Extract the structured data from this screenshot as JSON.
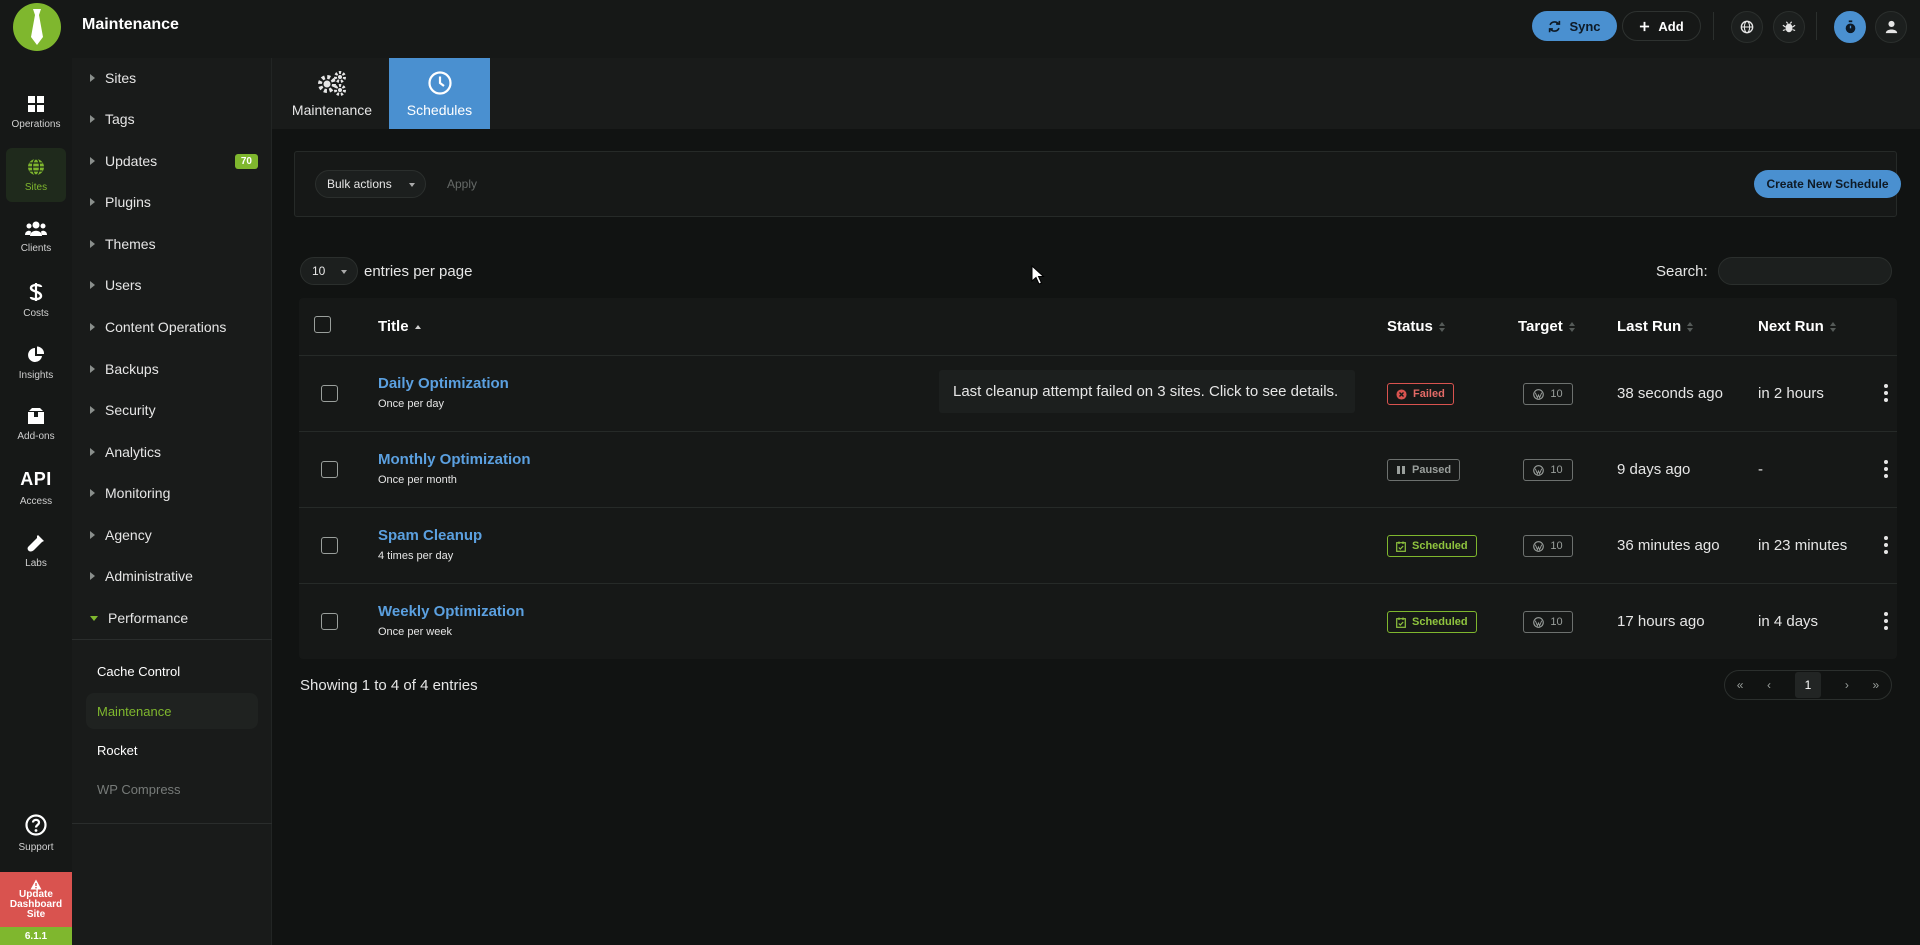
{
  "app": {
    "title": "Maintenance"
  },
  "top": {
    "sync_label": "Sync",
    "add_label": "Add"
  },
  "rail": {
    "items": [
      {
        "label": "Operations",
        "icon": "grid-icon"
      },
      {
        "label": "Sites",
        "icon": "globe-icon"
      },
      {
        "label": "Clients",
        "icon": "users-icon"
      },
      {
        "label": "Costs",
        "icon": "dollar-icon"
      },
      {
        "label": "Insights",
        "icon": "pie-chart-icon"
      },
      {
        "label": "Add-ons",
        "icon": "box-icon"
      },
      {
        "label": "Access",
        "icon_text": "API"
      },
      {
        "label": "Labs",
        "icon": "flask-icon"
      }
    ],
    "support_label": "Support",
    "update_label_1": "Update",
    "update_label_2": "Dashboard",
    "update_label_3": "Site",
    "version": "6.1.1"
  },
  "sidebar": {
    "items": [
      {
        "label": "Sites"
      },
      {
        "label": "Tags"
      },
      {
        "label": "Updates",
        "badge": "70"
      },
      {
        "label": "Plugins"
      },
      {
        "label": "Themes"
      },
      {
        "label": "Users"
      },
      {
        "label": "Content Operations"
      },
      {
        "label": "Backups"
      },
      {
        "label": "Security"
      },
      {
        "label": "Analytics"
      },
      {
        "label": "Monitoring"
      },
      {
        "label": "Agency"
      },
      {
        "label": "Administrative"
      },
      {
        "label": "Performance"
      }
    ],
    "sub_items": [
      {
        "label": "Cache Control"
      },
      {
        "label": "Maintenance"
      },
      {
        "label": "Rocket"
      },
      {
        "label": "WP Compress"
      }
    ]
  },
  "tabs": [
    {
      "label": "Maintenance",
      "icon": "gears-icon"
    },
    {
      "label": "Schedules",
      "icon": "clock-icon"
    }
  ],
  "toolbar": {
    "bulk_actions": "Bulk actions",
    "apply": "Apply",
    "create": "Create New Schedule"
  },
  "listing": {
    "per_page": "10",
    "per_page_label": "entries per page",
    "search_label": "Search:",
    "search_value": "",
    "showing": "Showing 1 to 4 of 4 entries"
  },
  "table": {
    "headers": {
      "title": "Title",
      "status": "Status",
      "target": "Target",
      "last_run": "Last Run",
      "next_run": "Next Run"
    },
    "rows": [
      {
        "title": "Daily Optimization",
        "frequency": "Once per day",
        "status": "Failed",
        "target": "10",
        "last_run": "38 seconds ago",
        "next_run": "in 2 hours"
      },
      {
        "title": "Monthly Optimization",
        "frequency": "Once per month",
        "status": "Paused",
        "target": "10",
        "last_run": "9 days ago",
        "next_run": "-"
      },
      {
        "title": "Spam Cleanup",
        "frequency": "4 times per day",
        "status": "Scheduled",
        "target": "10",
        "last_run": "36 minutes ago",
        "next_run": "in 23 minutes"
      },
      {
        "title": "Weekly Optimization",
        "frequency": "Once per week",
        "status": "Scheduled",
        "target": "10",
        "last_run": "17 hours ago",
        "next_run": "in 4 days"
      }
    ],
    "tooltip": "Last cleanup attempt failed on 3 sites. Click to see details."
  },
  "pager": {
    "first": "«",
    "prev": "‹",
    "current": "1",
    "next": "›",
    "last": "»"
  },
  "colors": {
    "accent_green": "#7fb72e",
    "accent_blue": "#4a90d0",
    "failed_red": "#d9534f"
  }
}
